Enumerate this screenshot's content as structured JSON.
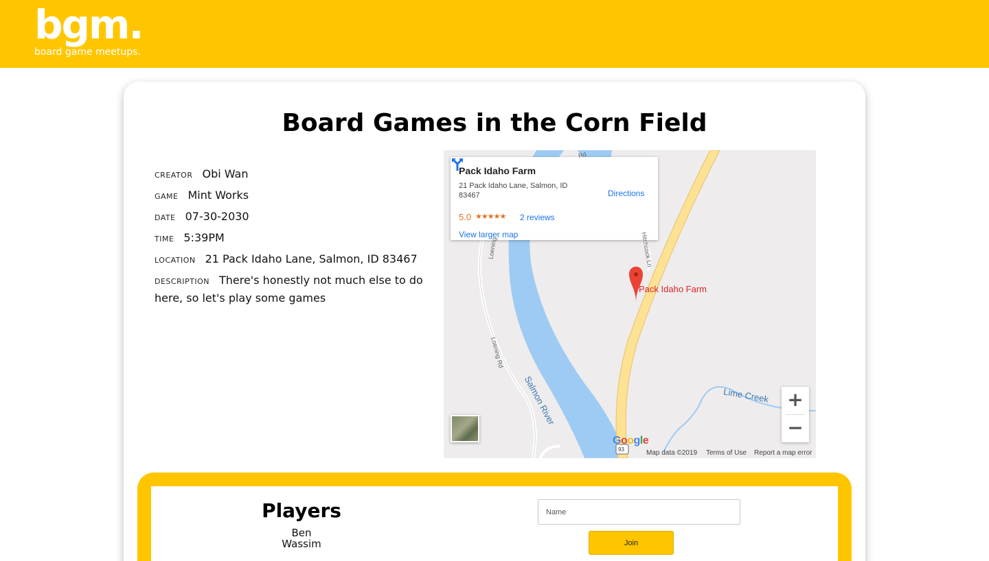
{
  "brand": {
    "logo": "bgm.",
    "tagline": "board game meetups."
  },
  "event": {
    "title": "Board Games in the Corn Field",
    "details": [
      {
        "label": "CREATOR",
        "value": "Obi Wan"
      },
      {
        "label": "GAME",
        "value": "Mint Works"
      },
      {
        "label": "DATE",
        "value": "07-30-2030"
      },
      {
        "label": "TIME",
        "value": "5:39PM"
      },
      {
        "label": "LOCATION",
        "value": "21 Pack Idaho Lane, Salmon, ID 83467"
      },
      {
        "label": "DESCRIPTION",
        "value": "There's honestly not much else to do here, so let's play some games"
      }
    ]
  },
  "map": {
    "place_name": "Pack Idaho Farm",
    "address": "21 Pack Idaho Lane, Salmon, ID 83467",
    "rating": "5.0",
    "stars": "★★★★★",
    "reviews": "2 reviews",
    "directions": "Directions",
    "view_larger": "View larger map",
    "pin_label": "Pack Idaho Farm",
    "river": "Salmon River",
    "creek": "Lime Creek",
    "roads": [
      "Loening",
      "Loening Rd",
      "Rd",
      "Hitchcock Ln"
    ],
    "highway": "93",
    "zoom_in": "+",
    "zoom_out": "−",
    "google": "Google",
    "map_data": "Map data ©2019",
    "terms": "Terms of Use",
    "report": "Report a map error",
    "colors": {
      "water": "#9ecbf3",
      "road": "#fde293",
      "land": "#eeecec",
      "pin": "#ea4335"
    }
  },
  "players": {
    "title": "Players",
    "list": [
      "Ben",
      "Wassim"
    ]
  },
  "join": {
    "placeholder": "Name",
    "button": "Join"
  },
  "colors": {
    "brand": "#ffc600"
  }
}
